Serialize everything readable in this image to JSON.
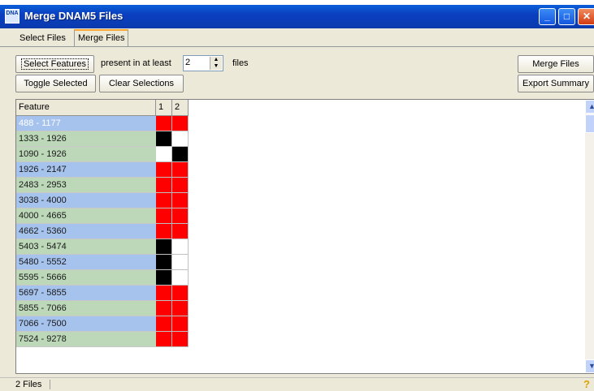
{
  "window": {
    "title": "Merge DNAM5 Files",
    "icon_text": "DNA"
  },
  "tabs": [
    "Select Files",
    "Merge Files"
  ],
  "active_tab": "Merge Files",
  "toolbar": {
    "select_features": "Select Features",
    "present_label": "present in at least",
    "present_value": "2",
    "files_label": "files",
    "toggle_selected": "Toggle Selected",
    "clear_selections": "Clear Selections",
    "merge_files": "Merge Files",
    "export_summary": "Export Summary"
  },
  "grid": {
    "headers": [
      "Feature",
      "1",
      "2"
    ],
    "colors": {
      "red": "#ff0000",
      "black": "#000000",
      "white": "#ffffff",
      "blue_row": "#a6c3ed",
      "green_row": "#bcd8b8"
    },
    "rows": [
      {
        "feature": "488 - 1177",
        "c1": "red",
        "c2": "red",
        "row_color": "blue",
        "selected": true
      },
      {
        "feature": "1333 - 1926",
        "c1": "black",
        "c2": "white",
        "row_color": "green"
      },
      {
        "feature": "1090 - 1926",
        "c1": "white",
        "c2": "black",
        "row_color": "green"
      },
      {
        "feature": "1926 - 2147",
        "c1": "red",
        "c2": "red",
        "row_color": "blue"
      },
      {
        "feature": "2483 - 2953",
        "c1": "red",
        "c2": "red",
        "row_color": "green"
      },
      {
        "feature": "3038 - 4000",
        "c1": "red",
        "c2": "red",
        "row_color": "blue"
      },
      {
        "feature": "4000 - 4665",
        "c1": "red",
        "c2": "red",
        "row_color": "green"
      },
      {
        "feature": "4662 - 5360",
        "c1": "red",
        "c2": "red",
        "row_color": "blue"
      },
      {
        "feature": "5403 - 5474",
        "c1": "black",
        "c2": "white",
        "row_color": "green"
      },
      {
        "feature": "5480 - 5552",
        "c1": "black",
        "c2": "white",
        "row_color": "blue"
      },
      {
        "feature": "5595 - 5666",
        "c1": "black",
        "c2": "white",
        "row_color": "green"
      },
      {
        "feature": "5697 - 5855",
        "c1": "red",
        "c2": "red",
        "row_color": "blue"
      },
      {
        "feature": "5855 - 7066",
        "c1": "red",
        "c2": "red",
        "row_color": "green"
      },
      {
        "feature": "7066 - 7500",
        "c1": "red",
        "c2": "red",
        "row_color": "blue"
      },
      {
        "feature": "7524 - 9278",
        "c1": "red",
        "c2": "red",
        "row_color": "green"
      }
    ]
  },
  "status": {
    "text": "2 Files",
    "help_icon": "?"
  }
}
